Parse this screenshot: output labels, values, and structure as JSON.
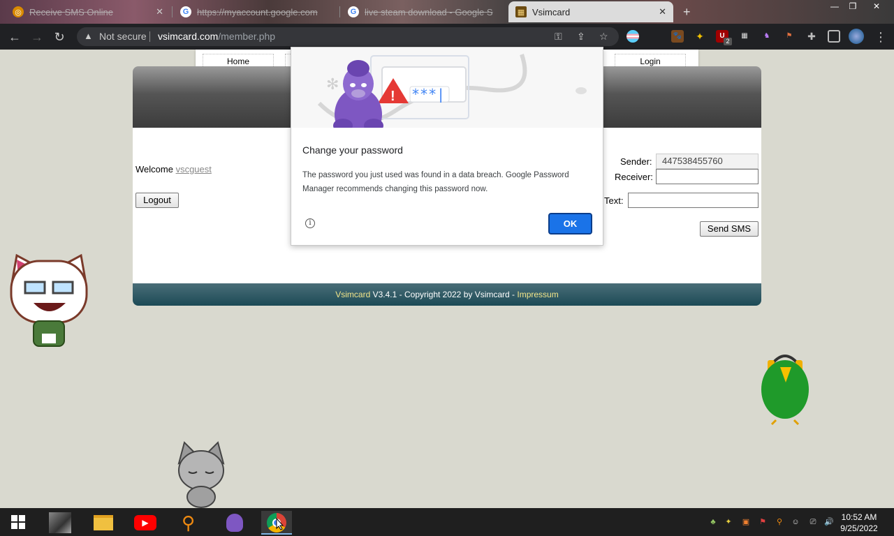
{
  "browser": {
    "tabs": [
      {
        "title": "Receive SMS Online",
        "active": false
      },
      {
        "title": "https://myaccount.google.com",
        "active": false
      },
      {
        "title": "live steam download - Google S",
        "active": false
      },
      {
        "title": "Vsimcard",
        "active": true
      }
    ],
    "close_glyph": "✕",
    "new_tab_glyph": "+",
    "window_controls": {
      "minimize": "—",
      "restore": "❐",
      "close": "✕"
    },
    "security_label": "Not secure",
    "url_domain": "vsimcard.com",
    "url_path": "/member.php",
    "ext_badge_count": "2"
  },
  "site": {
    "nav": {
      "home": "Home",
      "login": "Login"
    },
    "welcome_label": "Welcome",
    "username": "vscguest",
    "logout_label": "Logout",
    "form": {
      "sender_label": "Sender:",
      "sender_value": "447538455760",
      "receiver_label": "Receiver:",
      "receiver_value": "",
      "text_label": "Text:",
      "text_value": "",
      "send_label": "Send SMS"
    },
    "footer": {
      "brand": "Vsimcard",
      "version_text": " V3.4.1 - Copyright 2022 by Vsimcard - ",
      "impressum": "Impressum"
    }
  },
  "dialog": {
    "title": "Change your password",
    "body": "The password you just used was found in a data breach. Google Password Manager recommends changing this password now.",
    "ok_label": "OK",
    "info_glyph": "i",
    "password_mask": "***|"
  },
  "taskbar": {
    "time": "10:52 AM",
    "date": "9/25/2022"
  },
  "colors": {
    "dialog_accent": "#1a73e8",
    "footer_highlight": "#f3e68a",
    "warning_red": "#e53935"
  }
}
